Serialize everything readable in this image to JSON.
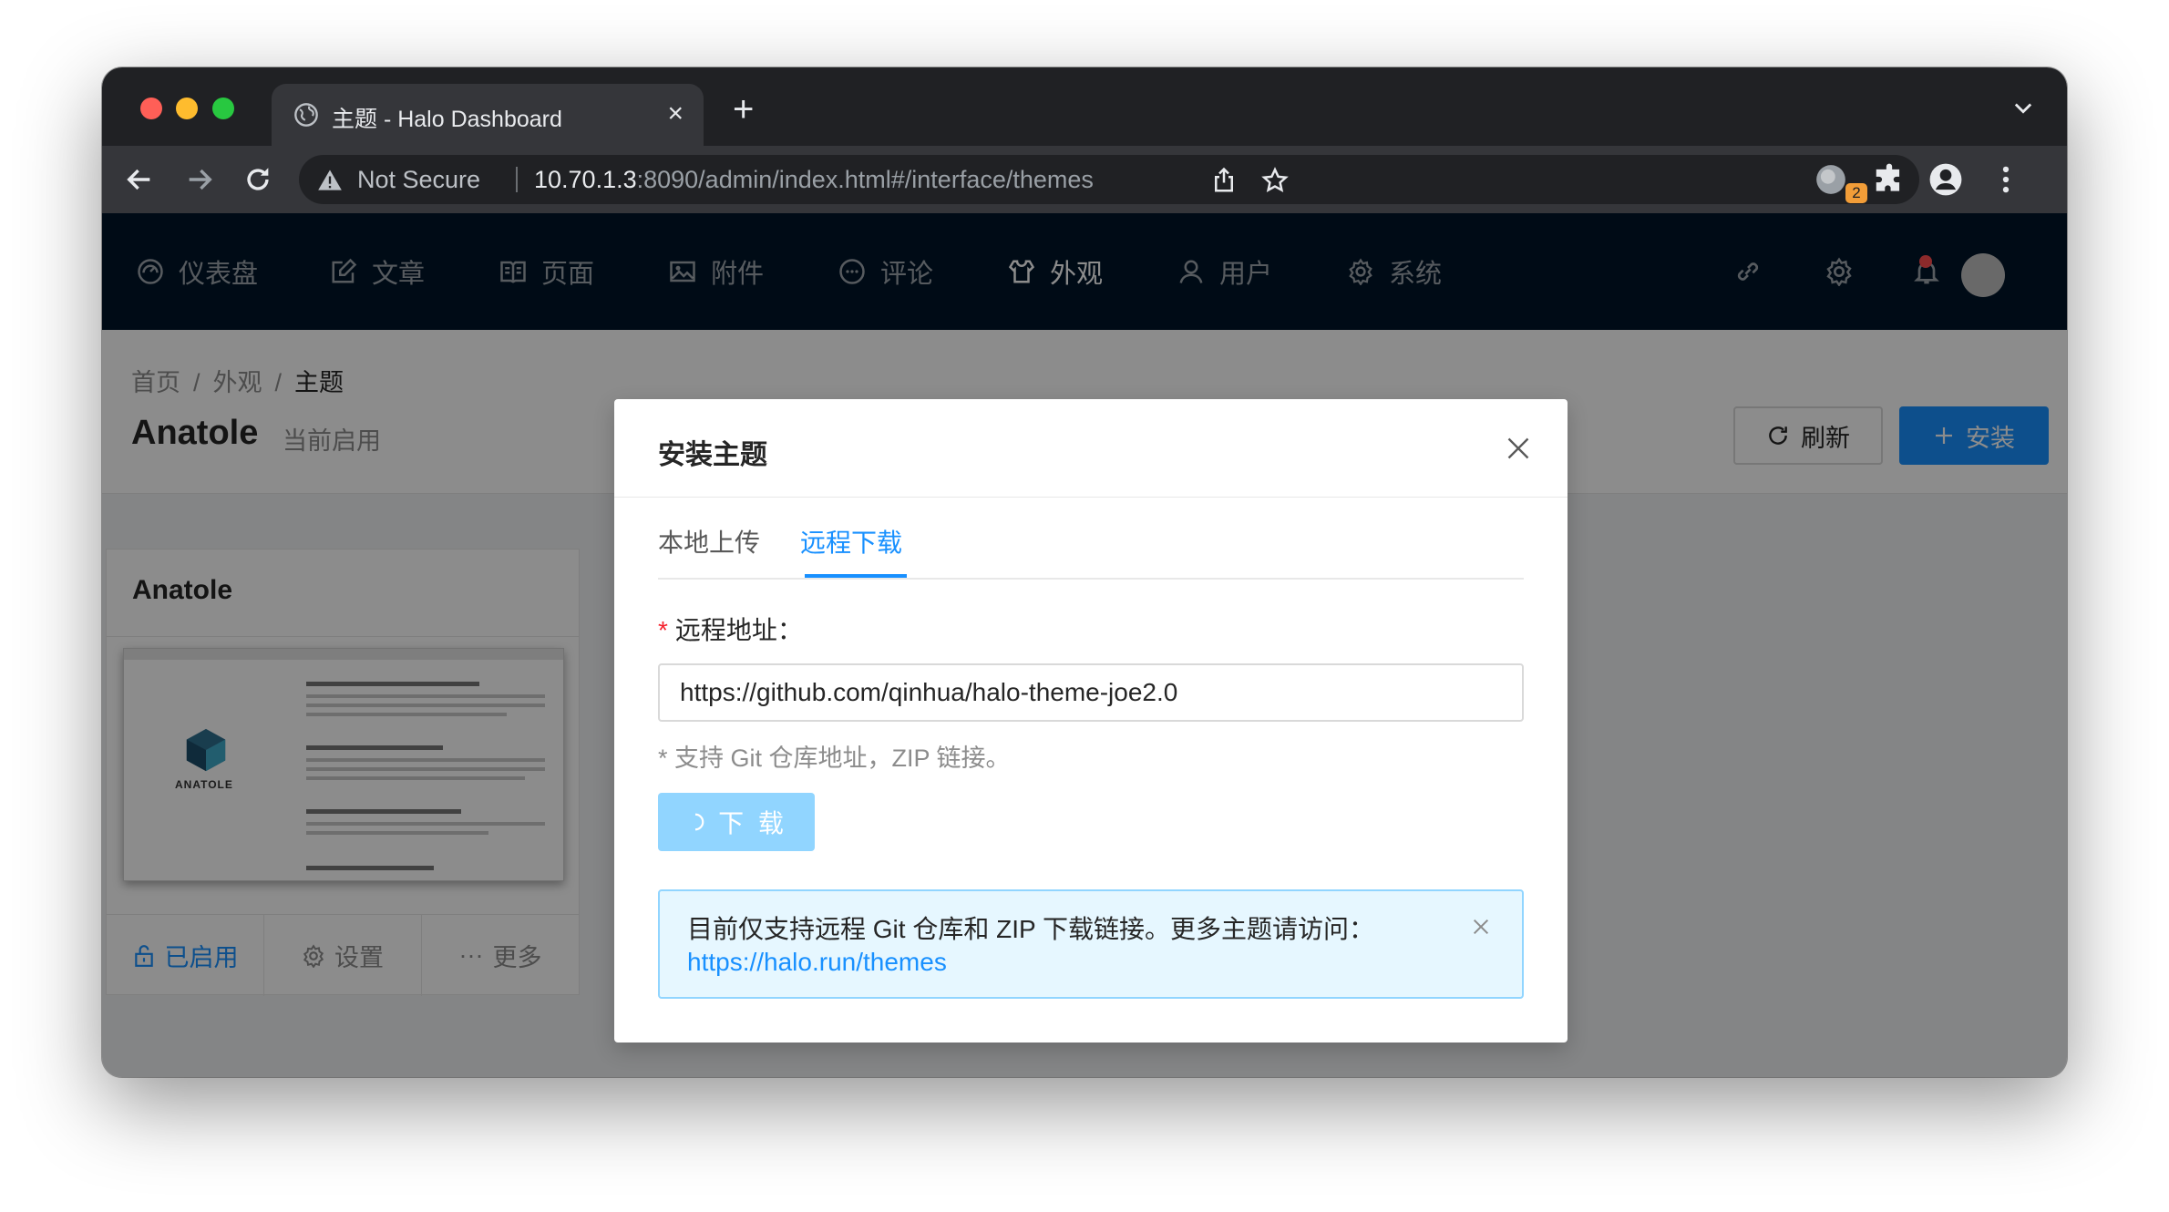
{
  "browser": {
    "tab_title": "主题 - Halo Dashboard",
    "tab_close": "×",
    "new_tab": "+",
    "security_label": "Not Secure",
    "url_host": "10.70.1.3",
    "url_rest": ":8090/admin/index.html#/interface/themes",
    "extension_badge": "2"
  },
  "nav": {
    "items": [
      {
        "label": "仪表盘",
        "icon": "dashboard-icon"
      },
      {
        "label": "文章",
        "icon": "edit-icon"
      },
      {
        "label": "页面",
        "icon": "book-icon"
      },
      {
        "label": "附件",
        "icon": "picture-icon"
      },
      {
        "label": "评论",
        "icon": "comment-icon"
      },
      {
        "label": "外观",
        "icon": "skin-icon",
        "active": true
      },
      {
        "label": "用户",
        "icon": "user-icon"
      },
      {
        "label": "系统",
        "icon": "setting-icon"
      }
    ]
  },
  "page": {
    "breadcrumb": [
      "首页",
      "外观",
      "主题"
    ],
    "breadcrumb_sep": "/",
    "title": "Anatole",
    "subtitle": "当前启用",
    "refresh_label": "刷新",
    "install_label": "安装"
  },
  "theme_card": {
    "title": "Anatole",
    "cover_name": "ANATOLE",
    "actions": {
      "enabled": "已启用",
      "settings": "设置",
      "more": "更多",
      "more_prefix": "···"
    }
  },
  "modal": {
    "title": "安装主题",
    "tabs": [
      "本地上传",
      "远程下载"
    ],
    "active_tab": "远程下载",
    "field_label": "远程地址：",
    "required_mark": "*",
    "field_value": "https://github.com/qinhua/halo-theme-joe2.0",
    "help_text": "* 支持 Git 仓库地址，ZIP 链接。",
    "download_label": "下 载",
    "alert_text": "目前仅支持远程 Git 仓库和 ZIP 下载链接。更多主题请访问：",
    "alert_link": "https://halo.run/themes"
  },
  "colors": {
    "primary": "#1890ff",
    "header_bg": "#001529",
    "alert_bg": "#e6f7ff",
    "download_disabled": "#91d5ff"
  }
}
